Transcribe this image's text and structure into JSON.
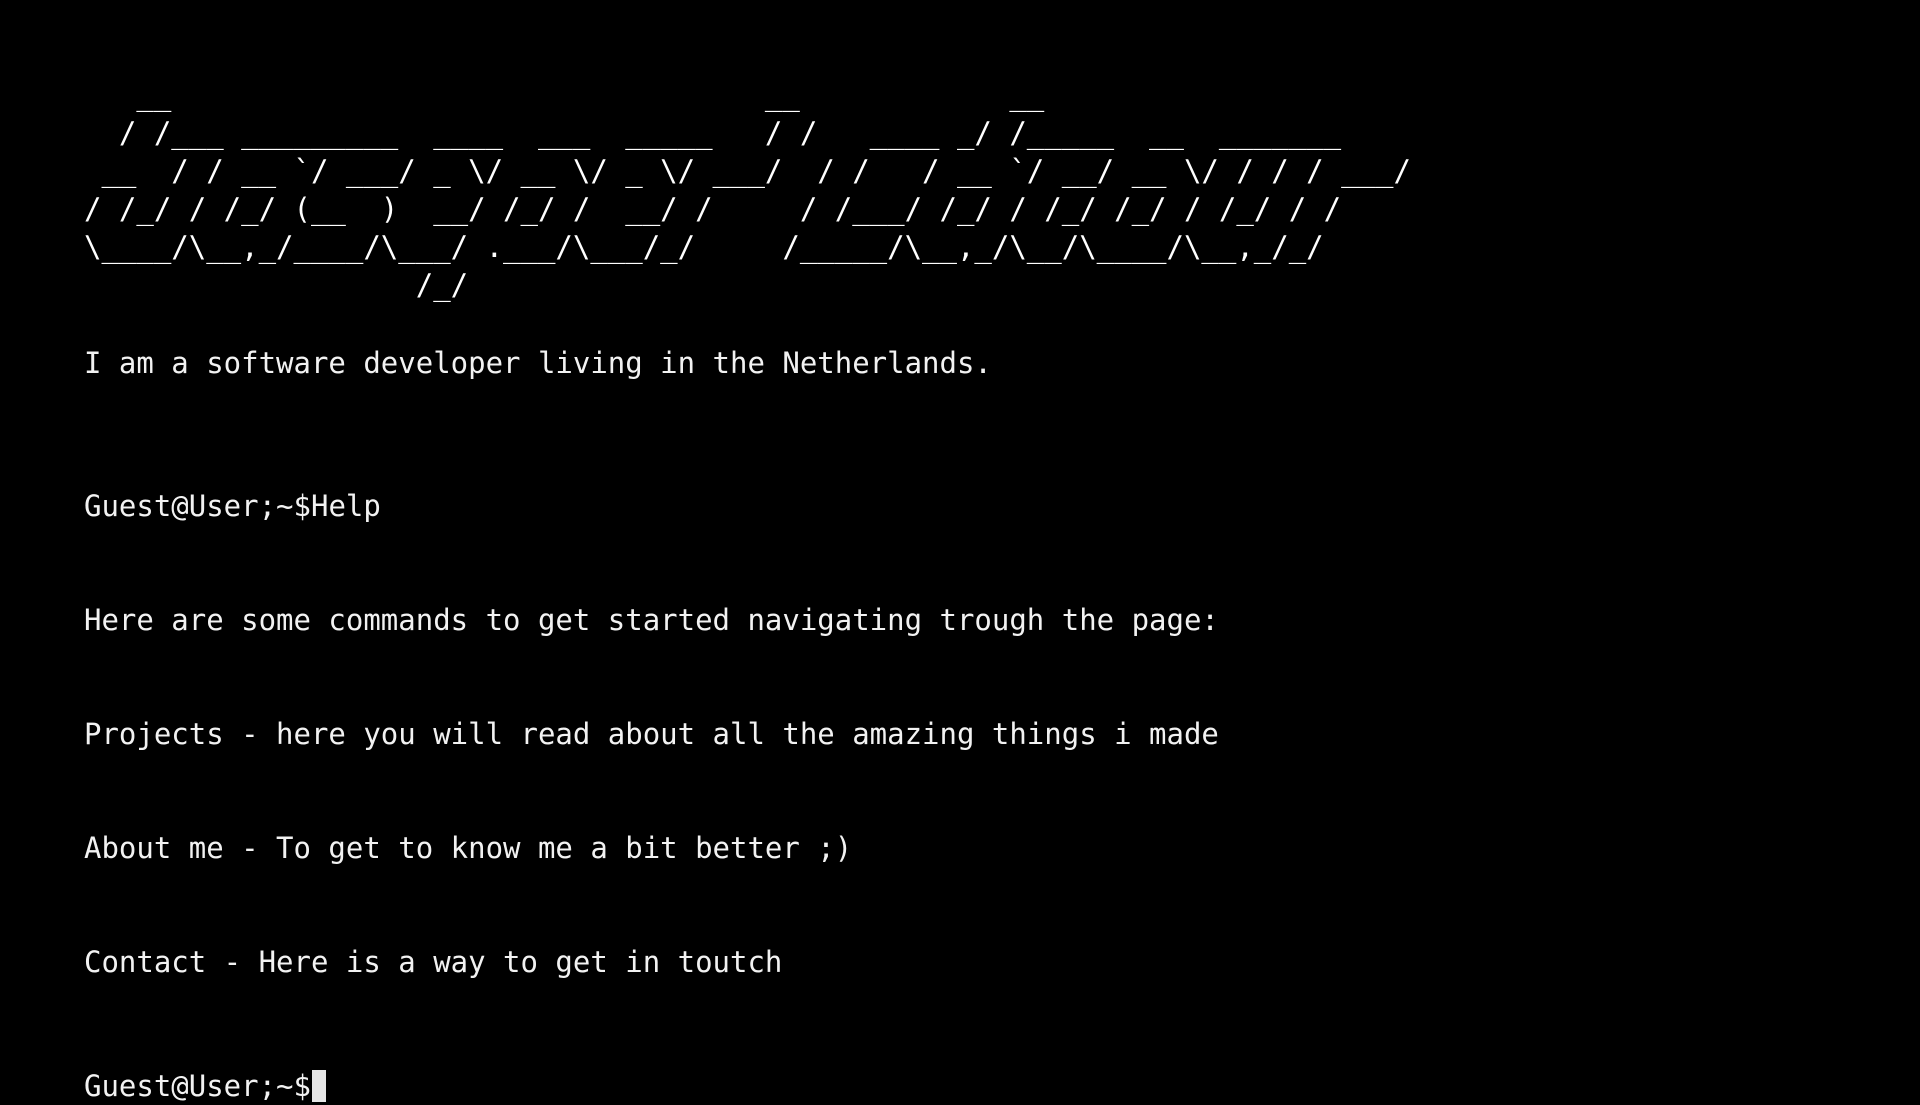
{
  "banner": {
    "ascii_art": "   __                                  __            __\n  / /___ _________  ____  ___  _____   / /   ____ _/ /_____  __  _______\n __  / / __ `/ ___/ _ \\/ __ \\/ _ \\/ ___/  / /   / __ `/ __/ __ \\/ / / / ___/\n/ /_/ / /_/ (__  )  __/ /_/ /  __/ /     / /___/ /_/ / /_/ /_/ / /_/ / /\n\\____/\\__,_/____/\\___/ .___/\\___/_/     /_____/\\__,_/\\__/\\____/\\__,_/_/\n                   /_/"
  },
  "intro": "I am a software developer living in the Netherlands.",
  "history": {
    "prompt": "Guest@User;~$",
    "command": "Help",
    "output": [
      "Here are some commands to get started navigating trough the page:",
      "Projects - here you will read about all the amazing things i made",
      "About me - To get to know me a bit better ;)",
      "Contact - Here is a way to get in toutch"
    ]
  },
  "active_prompt": {
    "prompt": "Guest@User;~$",
    "value": ""
  },
  "colors": {
    "background": "#000000",
    "text": "#f2f2f2",
    "cursor": "#e6e6e6"
  }
}
